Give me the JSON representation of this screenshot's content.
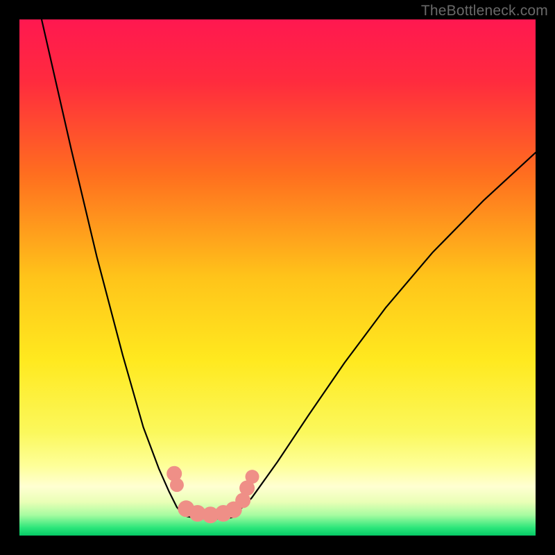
{
  "watermark": "TheBottleneck.com",
  "chart_data": {
    "type": "line",
    "title": "",
    "xlabel": "",
    "ylabel": "",
    "xlim": [
      0,
      1
    ],
    "ylim": [
      0,
      1
    ],
    "gradient_stops": [
      {
        "pos": 0.0,
        "color": "#ff1850"
      },
      {
        "pos": 0.12,
        "color": "#ff2b3e"
      },
      {
        "pos": 0.3,
        "color": "#ff6e1f"
      },
      {
        "pos": 0.5,
        "color": "#ffc41a"
      },
      {
        "pos": 0.66,
        "color": "#ffe91f"
      },
      {
        "pos": 0.8,
        "color": "#fbf85c"
      },
      {
        "pos": 0.865,
        "color": "#feff99"
      },
      {
        "pos": 0.905,
        "color": "#ffffd2"
      },
      {
        "pos": 0.935,
        "color": "#e9ffb6"
      },
      {
        "pos": 0.96,
        "color": "#a8fca1"
      },
      {
        "pos": 0.985,
        "color": "#2be67a"
      },
      {
        "pos": 1.0,
        "color": "#06c966"
      }
    ],
    "series": [
      {
        "name": "left-branch",
        "x": [
          0.043,
          0.1,
          0.15,
          0.2,
          0.24,
          0.27,
          0.29,
          0.305,
          0.315,
          0.325,
          0.336
        ],
        "y": [
          0.0,
          0.25,
          0.46,
          0.65,
          0.79,
          0.87,
          0.915,
          0.945,
          0.957,
          0.963,
          0.965
        ]
      },
      {
        "name": "floor",
        "x": [
          0.336,
          0.355,
          0.375,
          0.395,
          0.412
        ],
        "y": [
          0.965,
          0.967,
          0.968,
          0.967,
          0.965
        ]
      },
      {
        "name": "right-branch",
        "x": [
          0.412,
          0.45,
          0.5,
          0.56,
          0.63,
          0.71,
          0.8,
          0.9,
          1.0
        ],
        "y": [
          0.965,
          0.927,
          0.857,
          0.767,
          0.665,
          0.558,
          0.452,
          0.35,
          0.258
        ]
      }
    ],
    "markers": {
      "color": "#ef8f87",
      "points": [
        {
          "x": 0.3,
          "y": 0.88,
          "r": 11
        },
        {
          "x": 0.305,
          "y": 0.902,
          "r": 10
        },
        {
          "x": 0.323,
          "y": 0.948,
          "r": 12
        },
        {
          "x": 0.345,
          "y": 0.957,
          "r": 12
        },
        {
          "x": 0.37,
          "y": 0.96,
          "r": 12
        },
        {
          "x": 0.395,
          "y": 0.957,
          "r": 12
        },
        {
          "x": 0.415,
          "y": 0.95,
          "r": 12
        },
        {
          "x": 0.433,
          "y": 0.932,
          "r": 11
        },
        {
          "x": 0.441,
          "y": 0.908,
          "r": 11
        },
        {
          "x": 0.451,
          "y": 0.886,
          "r": 10
        }
      ]
    }
  }
}
